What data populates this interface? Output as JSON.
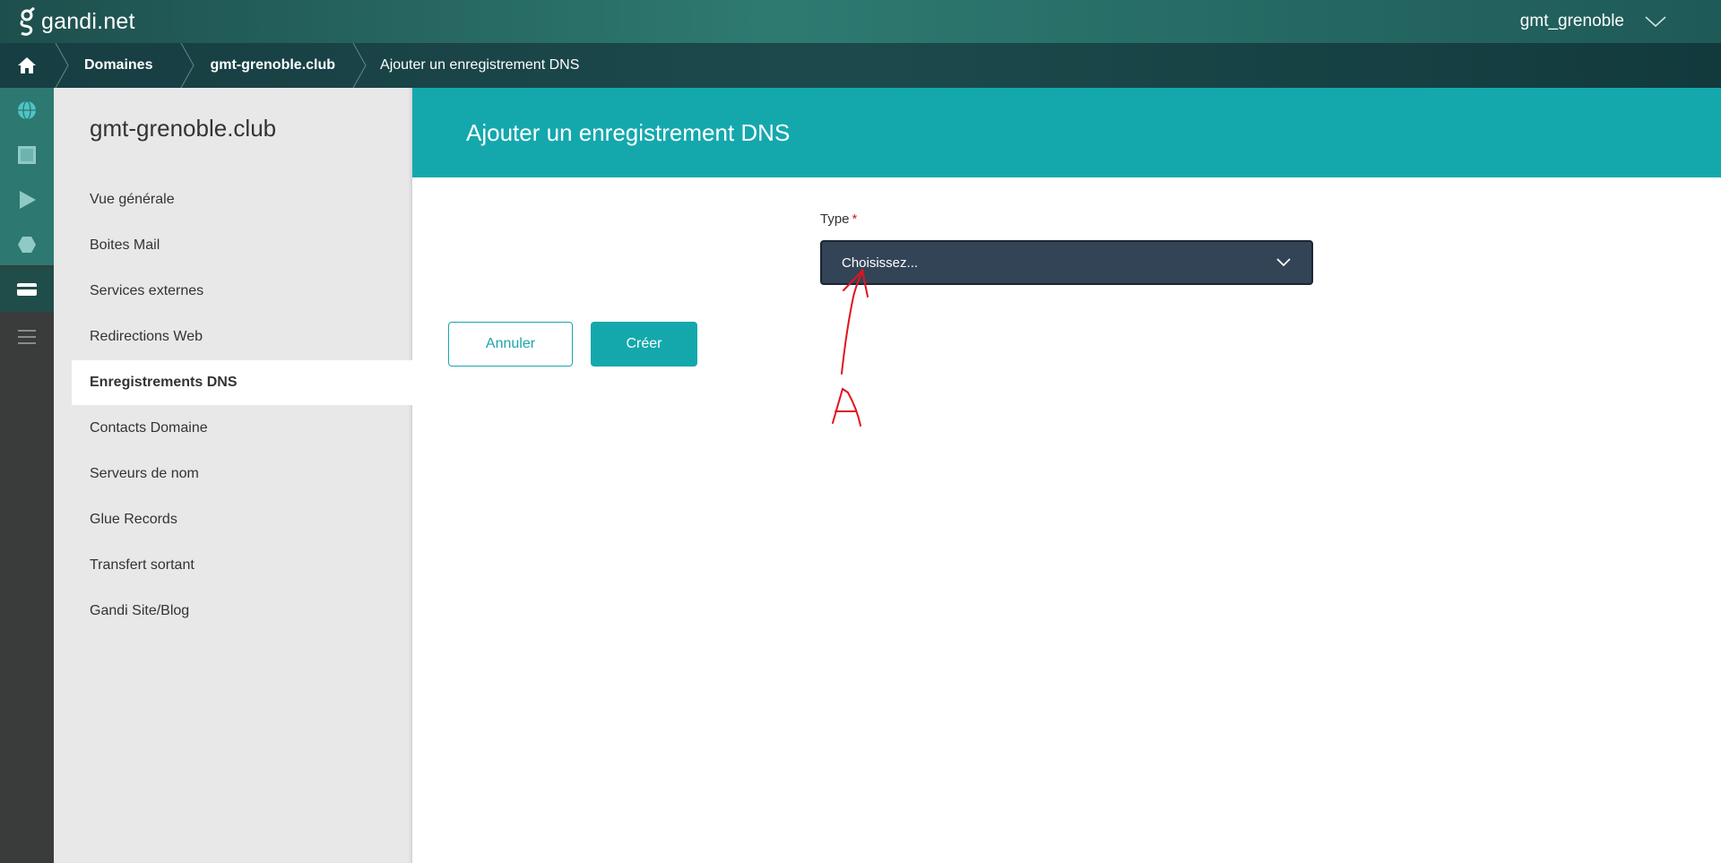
{
  "header": {
    "logo_text": "gandi.net",
    "username": "gmt_grenoble"
  },
  "breadcrumb": {
    "items": [
      "Domaines",
      "gmt-grenoble.club",
      "Ajouter un enregistrement DNS"
    ]
  },
  "rail": {
    "icons": [
      "globe-icon",
      "server-icon",
      "play-icon",
      "cube-icon",
      "card-icon",
      "menu-icon"
    ]
  },
  "sidebar": {
    "domain": "gmt-grenoble.club",
    "items": [
      {
        "label": "Vue générale"
      },
      {
        "label": "Boites Mail"
      },
      {
        "label": "Services externes"
      },
      {
        "label": "Redirections Web"
      },
      {
        "label": "Enregistrements DNS",
        "active": true
      },
      {
        "label": "Contacts Domaine"
      },
      {
        "label": "Serveurs de nom"
      },
      {
        "label": "Glue Records"
      },
      {
        "label": "Transfert sortant"
      },
      {
        "label": "Gandi Site/Blog"
      }
    ]
  },
  "main": {
    "title": "Ajouter un enregistrement DNS",
    "type_label": "Type",
    "required_marker": "*",
    "type_select_value": "Choisissez...",
    "cancel_label": "Annuler",
    "create_label": "Créer"
  },
  "annotation": {
    "letter": "A",
    "color": "#e0141e"
  },
  "colors": {
    "accent": "#14a8ad",
    "select_bg": "#344457",
    "sidebar_bg": "#e8e8e8",
    "rail_bg": "#3a3b3b"
  }
}
